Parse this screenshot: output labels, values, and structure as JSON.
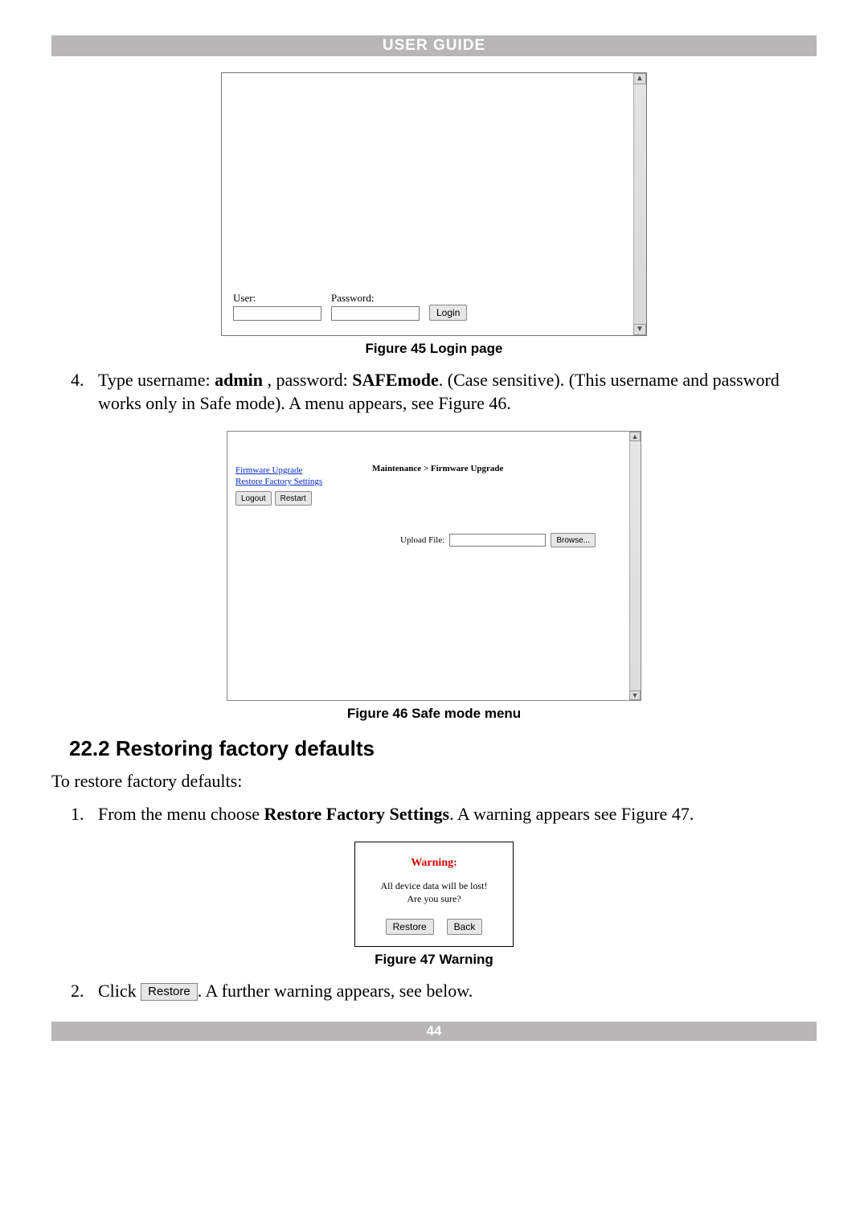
{
  "header": {
    "title": "USER GUIDE"
  },
  "footer": {
    "page_number": "44"
  },
  "fig45": {
    "user_label": "User:",
    "password_label": "Password:",
    "login_btn": "Login",
    "caption": "Figure 45 Login page",
    "scroll_up": "▲",
    "scroll_down": "▼"
  },
  "step4": {
    "num": "4.",
    "t1": "Type username: ",
    "b1": "admin",
    "t2": " , password: ",
    "b2": "SAFEmode",
    "t3": ". (Case sensitive). (This username and password works only in Safe mode). A menu appears, see Figure 46."
  },
  "fig46": {
    "link_fw": "Firmware Upgrade",
    "link_restore": "Restore Factory Settings",
    "btn_logout": "Logout",
    "btn_restart": "Restart",
    "breadcrumb": "Maintenance > Firmware Upgrade",
    "upload_label": "Upload File:",
    "browse_btn": "Browse...",
    "caption": "Figure 46 Safe mode menu",
    "scroll_up": "▲",
    "scroll_down": "▼"
  },
  "section": {
    "h22_2": "22.2 Restoring factory defaults"
  },
  "intro": {
    "text": "To restore factory defaults:"
  },
  "step1": {
    "num": "1.",
    "t1": "From the menu choose ",
    "b1": "Restore Factory Settings",
    "t2": ". A warning appears see Figure 47."
  },
  "fig47": {
    "title": "Warning:",
    "line1": "All device data will be lost!",
    "line2": "Are you sure?",
    "btn_restore": "Restore",
    "btn_back": "Back",
    "caption": "Figure 47 Warning"
  },
  "step2": {
    "num": "2.",
    "t1": "Click ",
    "btn_restore_inline": "Restore",
    "t2": ". A further warning appears, see below."
  }
}
